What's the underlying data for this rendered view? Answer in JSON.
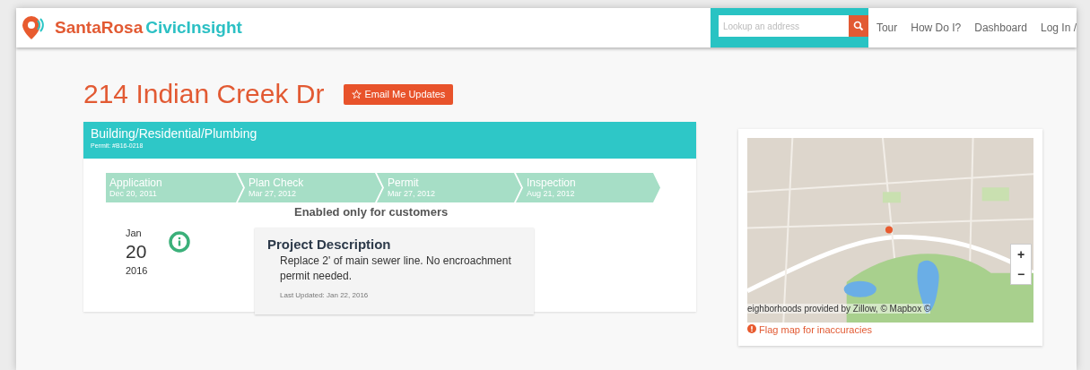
{
  "header": {
    "logo_part_1": "SantaRosa",
    "logo_part_2": "CivicInsight",
    "search": {
      "placeholder": "Lookup an address"
    },
    "nav": [
      "Tour",
      "How Do I?",
      "Dashboard",
      "Log In /"
    ]
  },
  "address": "214 Indian Creek Dr",
  "email_button": "Email Me Updates",
  "permit": {
    "title": "Building/Residential/Plumbing",
    "number": "Permit: #B16-0218",
    "steps": [
      {
        "label": "Application",
        "date": "Dec 20, 2011"
      },
      {
        "label": "Plan Check",
        "date": "Mar 27, 2012"
      },
      {
        "label": "Permit",
        "date": "Mar 27, 2012"
      },
      {
        "label": "Inspection",
        "date": "Aug 21, 2012"
      }
    ],
    "overlay": "Enabled only for customers",
    "event": {
      "month": "Jan",
      "day": "20",
      "year": "2016",
      "title": "Project Description",
      "body": "Replace 2' of main sewer line. No encroachment permit needed.",
      "updated": "Last Updated: Jan 22, 2016"
    }
  },
  "map": {
    "kind": "picture",
    "zoom_in": "+",
    "zoom_out": "−",
    "attribution": "eighborhoods provided by Zillow, © Mapbox ©",
    "flag_link": "Flag map for inaccuracies"
  }
}
